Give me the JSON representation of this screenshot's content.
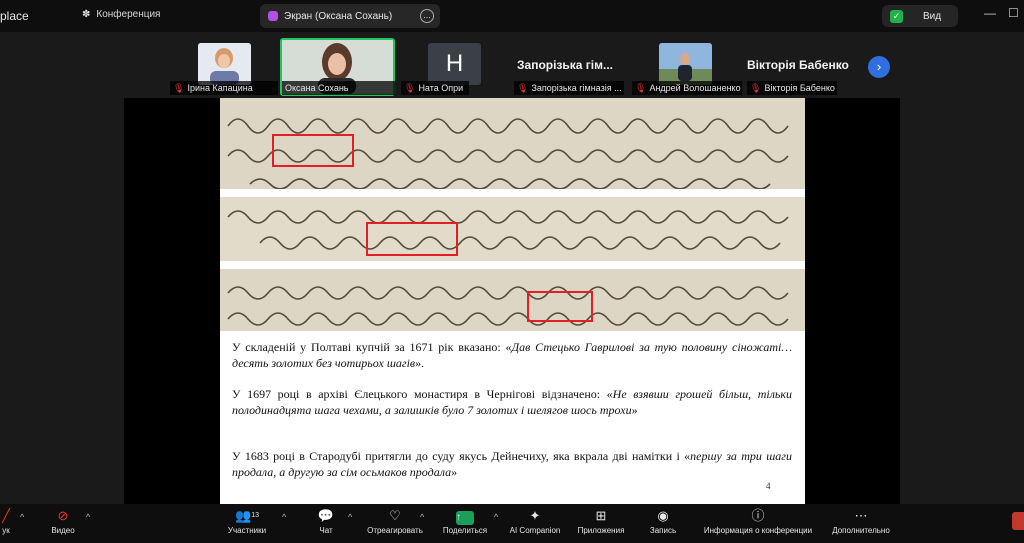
{
  "topbar": {
    "app_name_partial": "place",
    "conference_tab": "Конференция",
    "screen_tab": "Экран (Оксана Сохань)",
    "tab_menu": "...",
    "view_label": "Вид",
    "minimize": "—",
    "maximize": "☐"
  },
  "participants": [
    {
      "name": "Ірина Капацина"
    },
    {
      "name": "Оксана Сохань"
    },
    {
      "name": "Ната Опри",
      "initial": "H"
    },
    {
      "name": "Запорізька гімназія ...",
      "title": "Запорізька гім..."
    },
    {
      "name": "Андрей Волошаненко"
    },
    {
      "name": "Вікторія Бабенко",
      "title": "Вікторія Бабенко"
    }
  ],
  "slide": {
    "p1_plain": "У складеній у Полтаві купчій за 1671 рік вказано: «",
    "p1_italic": "Дав Стецько Гаврилові за тую половину сіножаті…десять золотих без чотирьох шагів",
    "p1_end": "».",
    "p2_plain": "У 1697 році в архіві Єлецького монастиря в Чернігові відзначено: «",
    "p2_italic": "Не взявши грошей більш, тільки полодинадцята шага чехами, а залишків було 7 золотих і шелягов шось трохи",
    "p2_end": "»",
    "p3_plain": "У 1683 році в Стародубі притягли до суду якусь Дейнечиху, яка вкрала дві намітки і «",
    "p3_italic": "першу за три шаги продала, а другую за сім осьмаков продала",
    "p3_end": "»",
    "page_number": "4"
  },
  "toolbar": {
    "audio_partial": "ук",
    "video": "Видео",
    "participants": "Участники",
    "participants_count": "13",
    "chat": "Чат",
    "react": "Отреагировать",
    "share": "Поделиться",
    "ai": "AI Companion",
    "apps": "Приложения",
    "record": "Запись",
    "info": "Информация о конференции",
    "more": "Дополнительно"
  },
  "colors": {
    "accent_green": "#22c55e",
    "share_green": "#1a9e5a",
    "highlight_red": "#e21f26",
    "next_blue": "#2f6fe0"
  }
}
